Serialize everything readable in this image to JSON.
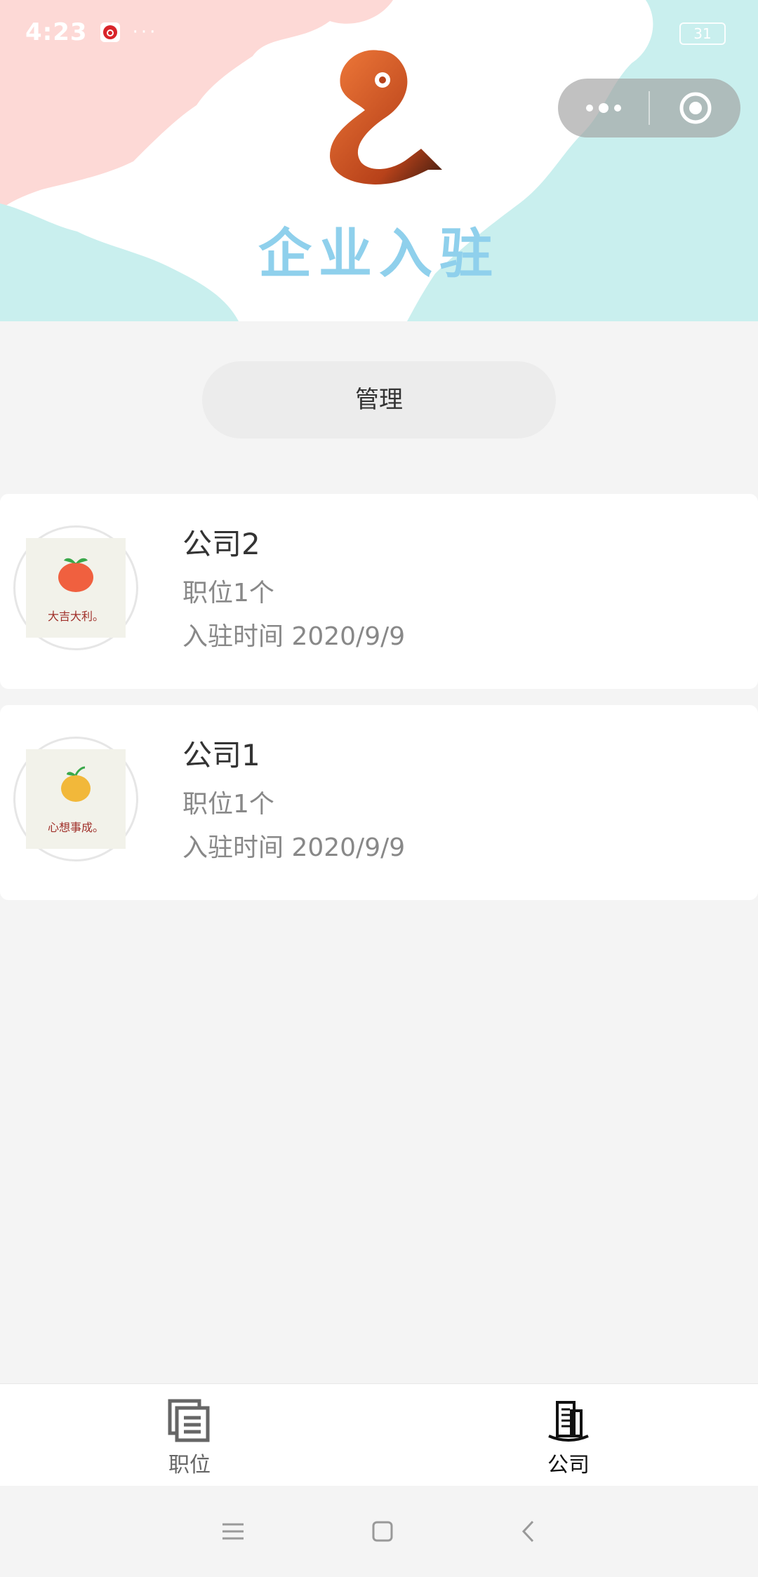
{
  "status_bar": {
    "time": "4:23",
    "dots": "···",
    "battery": "31"
  },
  "capsule": {
    "menu_icon": "more-dots-icon",
    "close_icon": "target-circle-icon"
  },
  "banner": {
    "title": "企业入驻",
    "colors": {
      "pink": "#fdd9d6",
      "cyan": "#c9efee",
      "title": "#8fd0ec",
      "logo": "#d85a24"
    }
  },
  "manage_button": {
    "label": "管理"
  },
  "companies": [
    {
      "name": "公司2",
      "jobs": "职位1个",
      "date": "入驻时间 2020/9/9",
      "logo_caption": "大吉大利。",
      "logo_fruit_color": "#f0603f"
    },
    {
      "name": "公司1",
      "jobs": "职位1个",
      "date": "入驻时间 2020/9/9",
      "logo_caption": "心想事成。",
      "logo_fruit_color": "#f2b83a"
    }
  ],
  "tabbar": {
    "tabs": [
      {
        "label": "职位",
        "icon": "document-list-icon",
        "active": false
      },
      {
        "label": "公司",
        "icon": "building-icon",
        "active": true
      }
    ]
  },
  "system_nav": {
    "menu_icon": "menu-lines-icon",
    "home_icon": "home-square-icon",
    "back_icon": "back-chevron-icon"
  }
}
